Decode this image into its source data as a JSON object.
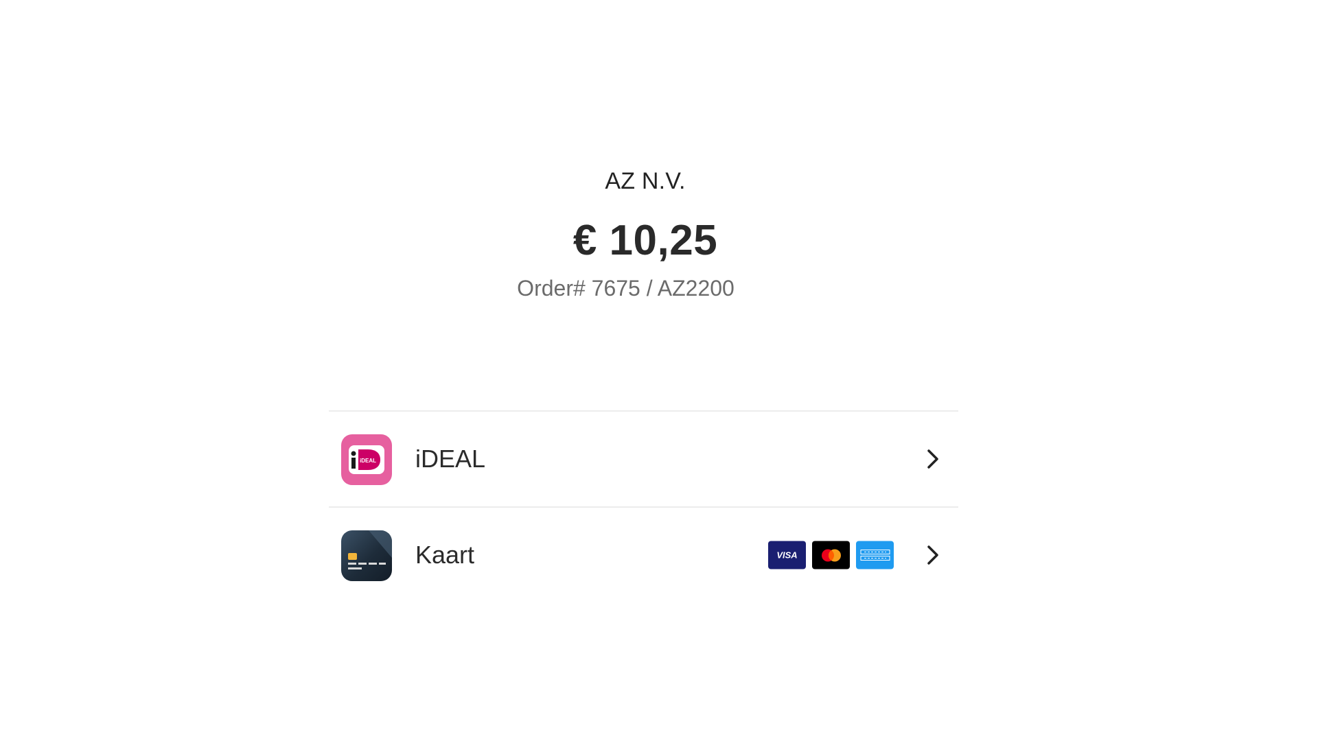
{
  "merchant": {
    "name": "AZ N.V."
  },
  "payment": {
    "amount": "€ 10,25",
    "order": "Order# 7675 / AZ2200"
  },
  "methods": [
    {
      "label": "iDEAL",
      "icon": "ideal-logo-icon",
      "icon_text": "iDEAL"
    },
    {
      "label": "Kaart",
      "icon": "credit-card-icon",
      "brands": [
        {
          "name": "VISA",
          "color": "#1a1f71"
        },
        {
          "name": "Mastercard",
          "color": "#000000"
        },
        {
          "name": "American Express",
          "color": "#1f9bf0"
        }
      ]
    }
  ],
  "colors": {
    "ideal_pink": "#e6609f",
    "card_dark": "#1e2c3a",
    "divider": "#ececec"
  }
}
